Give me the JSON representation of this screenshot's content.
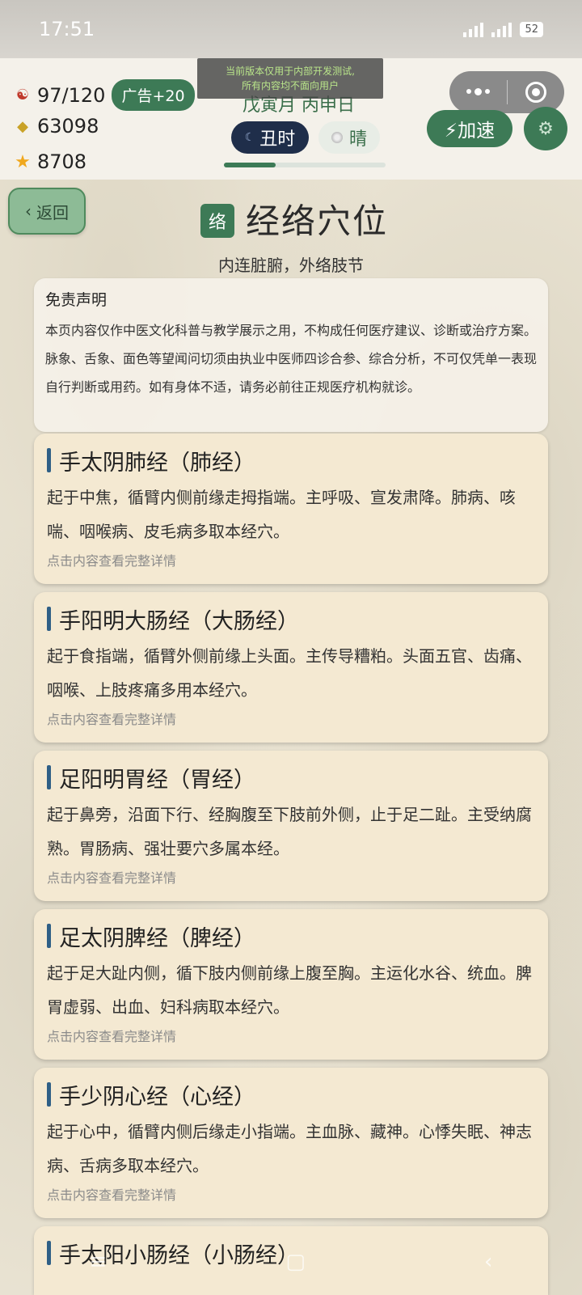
{
  "status": {
    "time": "17:51",
    "battery": "52"
  },
  "stats": {
    "energy": "97/120",
    "ad_bonus": "广告+20",
    "coins": "63098",
    "stars": "8708"
  },
  "dev_banner": {
    "line1": "当前版本仅用于内部开发测试,",
    "line2": "所有内容均不面向用户"
  },
  "calendar": {
    "lunar_date": "戊寅月 丙申日",
    "hour": "丑时",
    "weather": "晴",
    "progress_fraction": 0.32
  },
  "actions": {
    "speed_label": "⚡加速"
  },
  "back_label": "返回",
  "page": {
    "badge": "络",
    "title": "经络穴位",
    "subtitle": "内连脏腑，外络肢节"
  },
  "disclaimer": {
    "title": "免责声明",
    "body": "本页内容仅作中医文化科普与教学展示之用，不构成任何医疗建议、诊断或治疗方案。脉象、舌象、面色等望闻问切须由执业中医师四诊合参、综合分析，不可仅凭单一表现自行判断或用药。如有身体不适，请务必前往正规医疗机构就诊。"
  },
  "meridians": [
    {
      "title": "手太阴肺经（肺经）",
      "desc": "起于中焦，循臂内侧前缘走拇指端。主呼吸、宣发肃降。肺病、咳喘、咽喉病、皮毛病多取本经穴。",
      "hint": "点击内容查看完整详情"
    },
    {
      "title": "手阳明大肠经（大肠经）",
      "desc": "起于食指端，循臂外侧前缘上头面。主传导糟粕。头面五官、齿痛、咽喉、上肢疼痛多用本经穴。",
      "hint": "点击内容查看完整详情"
    },
    {
      "title": "足阳明胃经（胃经）",
      "desc": "起于鼻旁，沿面下行、经胸腹至下肢前外侧，止于足二趾。主受纳腐熟。胃肠病、强壮要穴多属本经。",
      "hint": "点击内容查看完整详情"
    },
    {
      "title": "足太阴脾经（脾经）",
      "desc": "起于足大趾内侧，循下肢内侧前缘上腹至胸。主运化水谷、统血。脾胃虚弱、出血、妇科病取本经穴。",
      "hint": "点击内容查看完整详情"
    },
    {
      "title": "手少阴心经（心经）",
      "desc": "起于心中，循臂内侧后缘走小指端。主血脉、藏神。心悸失眠、神志病、舌病多取本经穴。",
      "hint": "点击内容查看完整详情"
    },
    {
      "title": "手太阳小肠经（小肠经）",
      "desc": "",
      "hint": ""
    }
  ],
  "colors": {
    "accent_green": "#3d7a56",
    "card_bg": "#f4e9d2",
    "title_bar_blue": "#2f5f86",
    "time_pill_navy": "#1f2e4a"
  }
}
